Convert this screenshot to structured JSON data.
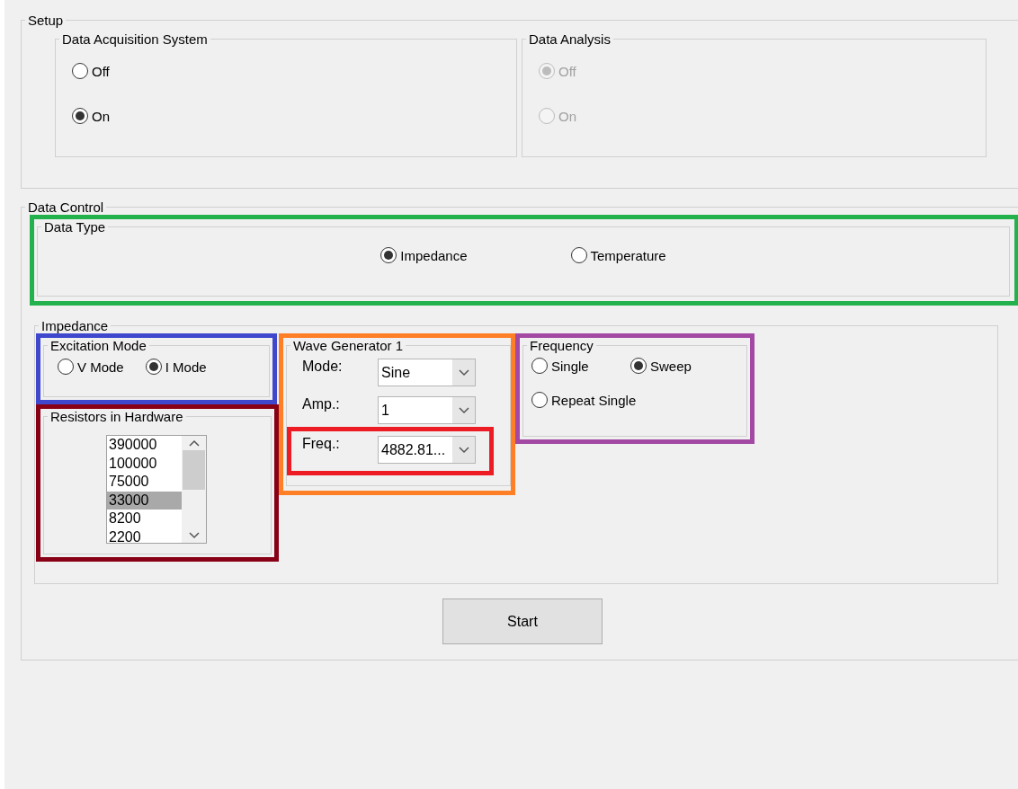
{
  "setup": {
    "title": "Setup",
    "groups": [
      {
        "title": "Data Acquisition System",
        "disabled": false,
        "options": [
          {
            "label": "Off",
            "selected": false
          },
          {
            "label": "On",
            "selected": true
          }
        ]
      },
      {
        "title": "Data Analysis",
        "disabled": true,
        "options": [
          {
            "label": "Off",
            "selected": true
          },
          {
            "label": "On",
            "selected": false
          }
        ]
      }
    ]
  },
  "data_control": {
    "title": "Data Control",
    "data_type": {
      "title": "Data Type",
      "color": "#22b14c",
      "options": [
        {
          "label": "Impedance",
          "selected": true
        },
        {
          "label": "Temperature",
          "selected": false
        }
      ]
    },
    "impedance": {
      "title": "Impedance",
      "excitation_mode": {
        "title": "Excitation Mode",
        "color": "#3f48cc",
        "options": [
          {
            "label": "V Mode",
            "selected": false
          },
          {
            "label": "I Mode",
            "selected": true
          }
        ]
      },
      "resistors": {
        "title": "Resistors in Hardware",
        "color": "#880015",
        "items": [
          {
            "label": "390000",
            "selected": false
          },
          {
            "label": "100000",
            "selected": false
          },
          {
            "label": "75000",
            "selected": false
          },
          {
            "label": "33000",
            "selected": true
          },
          {
            "label": "8200",
            "selected": false
          },
          {
            "label": "2200",
            "selected": false
          }
        ]
      },
      "wave_generator": {
        "title": "Wave Generator 1",
        "color": "#ff7f27",
        "fields": [
          {
            "label": "Mode:",
            "value": "Sine"
          },
          {
            "label": "Amp.:",
            "value": "1"
          },
          {
            "label": "Freq.:",
            "value": "4882.81...",
            "color": "#ed1c24"
          }
        ]
      },
      "frequency": {
        "title": "Frequency",
        "color": "#a349a4",
        "options": [
          {
            "label": "Single",
            "selected": false
          },
          {
            "label": "Sweep",
            "selected": true
          },
          {
            "label": "Repeat Single",
            "selected": false
          }
        ]
      }
    },
    "start_button": "Start"
  }
}
